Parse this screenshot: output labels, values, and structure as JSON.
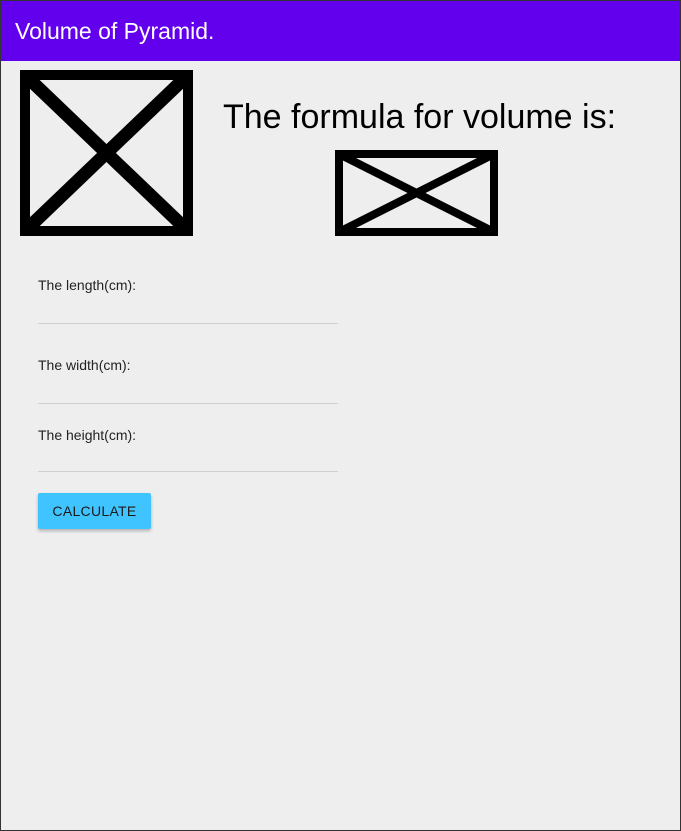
{
  "app": {
    "title": "Volume of Pyramid."
  },
  "images": {
    "pyramid": "broken-image-icon",
    "formula": "broken-image-icon"
  },
  "formula": {
    "heading": "The formula for volume is:"
  },
  "form": {
    "length_label": "The length(cm):",
    "length_value": "",
    "width_label": "The width(cm):",
    "width_value": "",
    "height_label": "The height(cm):",
    "height_value": "",
    "calculate_label": "CALCULATE"
  },
  "colors": {
    "appbar": "#6200ee",
    "button": "#40c4ff",
    "background": "#eeeeee"
  }
}
